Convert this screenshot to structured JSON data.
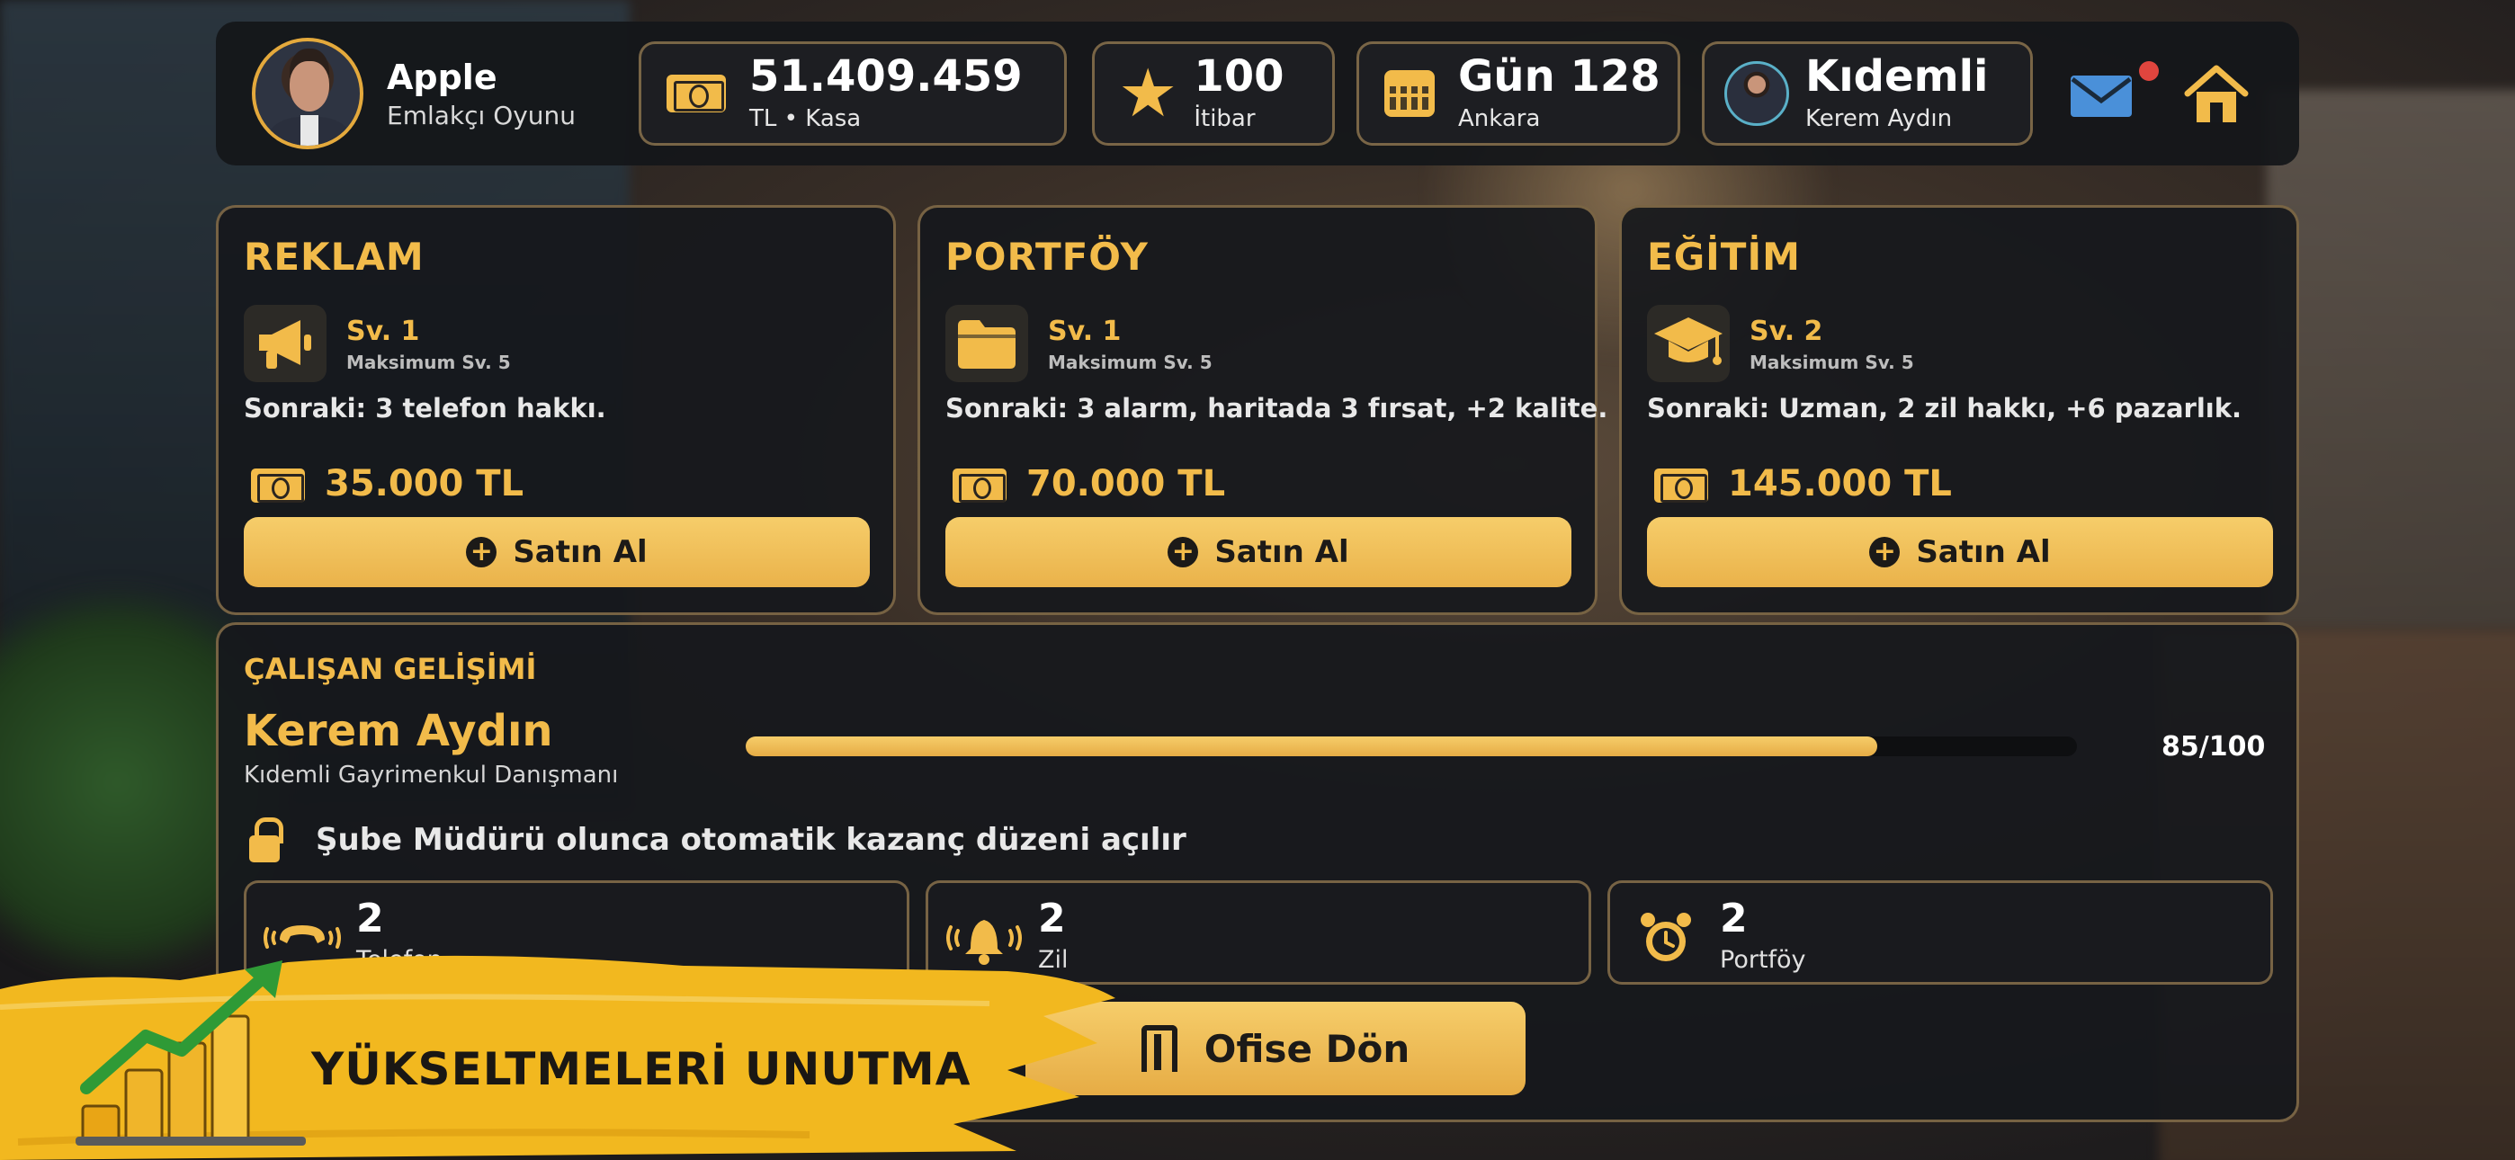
{
  "player": {
    "name": "Apple",
    "subtitle": "Emlakçı Oyunu"
  },
  "stats": {
    "money": {
      "value": "51.409.459",
      "label": "TL • Kasa",
      "icon": "money-icon"
    },
    "reputation": {
      "value": "100",
      "label": "İtibar",
      "icon": "star-icon"
    },
    "day": {
      "value": "Gün 128",
      "label": "Ankara",
      "icon": "calendar-icon"
    },
    "employee": {
      "value": "Kıdemli",
      "label": "Kerem Aydın",
      "icon": "avatar"
    }
  },
  "cards": [
    {
      "title": "REKLAM",
      "level": "Sv. 1",
      "max": "Maksimum Sv. 5",
      "next": "Sonraki: 3 telefon hakkı.",
      "price": "35.000 TL",
      "button": "Satın Al",
      "icon": "megaphone-icon"
    },
    {
      "title": "PORTFÖY",
      "level": "Sv. 1",
      "max": "Maksimum Sv. 5",
      "next": "Sonraki: 3 alarm, haritada 3 fırsat, +2 kalite.",
      "price": "70.000 TL",
      "button": "Satın Al",
      "icon": "folder-icon"
    },
    {
      "title": "EĞİTİM",
      "level": "Sv. 2",
      "max": "Maksimum Sv. 5",
      "next": "Sonraki: Uzman, 2 zil hakkı, +6 pazarlık.",
      "price": "145.000 TL",
      "button": "Satın Al",
      "icon": "graduation-cap-icon"
    }
  ],
  "employee": {
    "heading": "ÇALIŞAN GELİŞİMİ",
    "name": "Kerem Aydın",
    "role": "Kıdemli Gayrimenkul Danışmanı",
    "progress_text": "85/100",
    "progress": 0.85,
    "lock_text": "Şube Müdürü olunca otomatik kazanç düzeni açılır",
    "perks": [
      {
        "value": "2",
        "label": "Telefon",
        "icon": "phone-icon"
      },
      {
        "value": "2",
        "label": "Zil",
        "icon": "bell-icon"
      },
      {
        "value": "2",
        "label": "Portföy",
        "icon": "alarm-clock-icon"
      }
    ]
  },
  "office_button": "Ofise Dön",
  "banner_text": "YÜKSELTMELERİ UNUTMA",
  "colors": {
    "accent": "#f2bb4a",
    "panel": "#16181c",
    "border": "#c4a064",
    "notification": "#e0453e"
  }
}
